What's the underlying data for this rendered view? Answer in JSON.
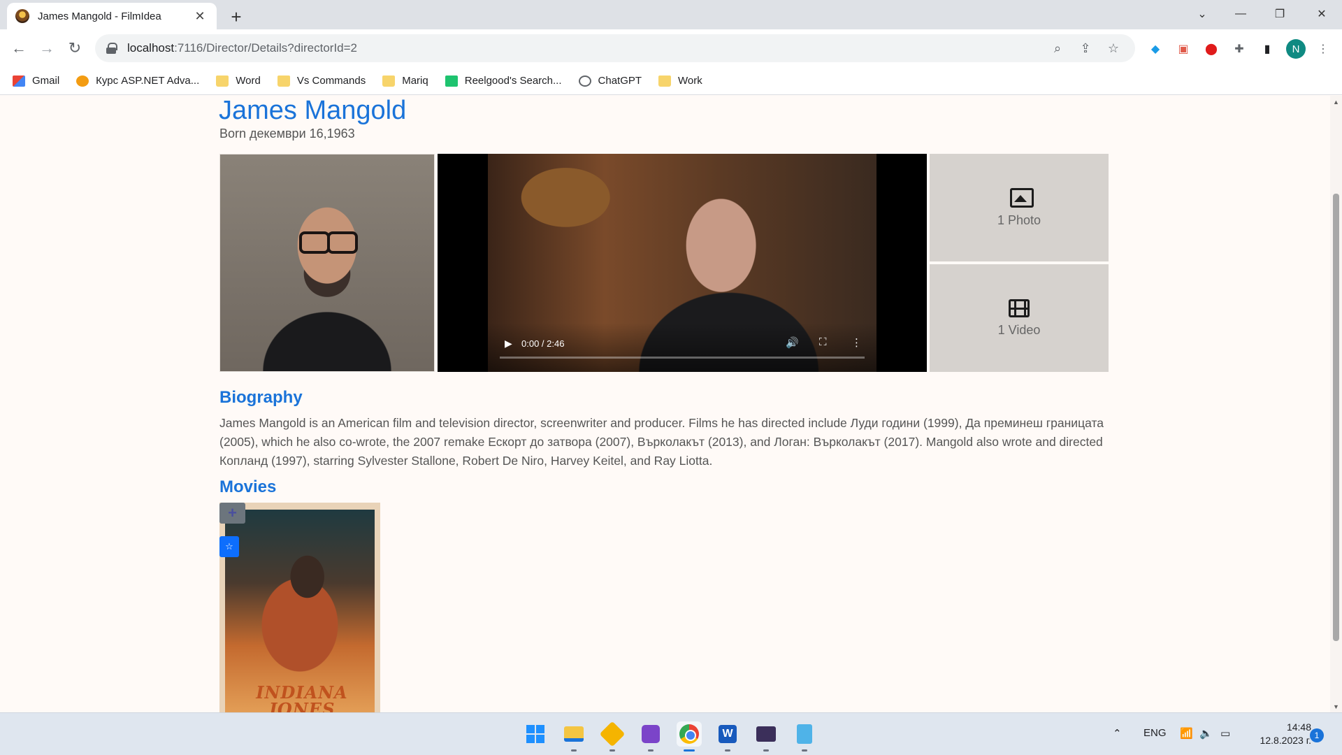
{
  "browser": {
    "tab_title": "James Mangold - FilmIdea",
    "tab_close": "✕",
    "new_tab": "+",
    "url_host": "localhost",
    "url_path": ":7116/Director/Details?directorId=2",
    "profile_initial": "N",
    "icons": [
      "back-icon",
      "forward-icon",
      "reload-icon",
      "lock-icon",
      "zoom-icon",
      "share-icon",
      "star-icon",
      "extensions-icon",
      "sidepanel-icon",
      "menu-icon"
    ]
  },
  "bookmarks": [
    {
      "label": "Gmail",
      "icon": "gmail-icon"
    },
    {
      "label": "Курс ASP.NET Adva...",
      "icon": "kurs-icon"
    },
    {
      "label": "Word",
      "icon": "folder-icon"
    },
    {
      "label": "Vs Commands",
      "icon": "folder-icon"
    },
    {
      "label": "Mariq",
      "icon": "folder-icon"
    },
    {
      "label": "Reelgood's Search...",
      "icon": "reel-icon"
    },
    {
      "label": "ChatGPT",
      "icon": "gpt-icon"
    },
    {
      "label": "Work",
      "icon": "folder-icon"
    }
  ],
  "director": {
    "name": "James Mangold",
    "born": "Born декември 16,1963"
  },
  "video": {
    "time": "0:00 / 2:46",
    "progress": 0
  },
  "media": {
    "photos_label": "1 Photo",
    "videos_label": "1 Video"
  },
  "biography": {
    "title": "Biography",
    "text": "James Mangold is an American film and television director, screenwriter and producer. Films he has directed include Луди години (1999), Да преминеш границата (2005), which he also co-wrote, the 2007 remake Ескорт до затвора (2007), Върколакът (2013), and Логан: Върколакът (2017). Mangold also wrote and directed Копланд (1997), starring Sylvester Stallone, Robert De Niro, Harvey Keitel, and Ray Liotta."
  },
  "movies": {
    "title": "Movies",
    "items": [
      {
        "poster_title": "INDIANA JONES",
        "add_label": "+",
        "fav_label": "☆"
      }
    ]
  },
  "taskbar": {
    "apps": [
      "start",
      "file-explorer",
      "excel",
      "visual-studio",
      "chrome",
      "word",
      "terminal",
      "notepad"
    ],
    "language": "ENG",
    "time": "14:48",
    "date": "12.8.2023 г.",
    "notification_count": "1"
  }
}
